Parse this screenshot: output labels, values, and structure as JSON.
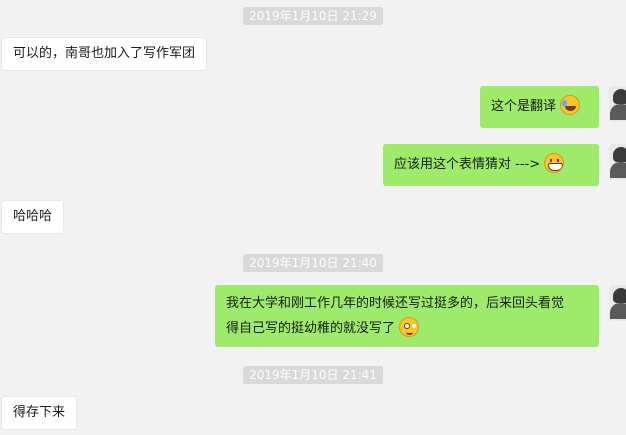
{
  "timestamps": [
    "2019年1月10日 21:29",
    "2019年1月10日 21:40",
    "2019年1月10日 21:41"
  ],
  "messages": [
    {
      "side": "left",
      "text": "可以的，南哥也加入了写作军团"
    },
    {
      "side": "right",
      "text": "这个是翻译",
      "emoji": "laugh-cry-emoji"
    },
    {
      "side": "right",
      "text": "应该用这个表情猜对 --->",
      "emoji": "grin-emoji"
    },
    {
      "side": "left",
      "text": "哈哈哈"
    },
    {
      "side": "right",
      "line1": "我在大学和刚工作几年的时候还写过挺多的，后来回头看觉",
      "line2": "得自己写的挺幼稚的就没写了",
      "emoji": "awkward-emoji"
    },
    {
      "side": "left",
      "text": "得存下来"
    }
  ],
  "colors": {
    "background": "#f2f2f2",
    "sent_bubble": "#9eea6a",
    "received_bubble": "#ffffff",
    "timestamp_bg": "#d9d9d9"
  }
}
